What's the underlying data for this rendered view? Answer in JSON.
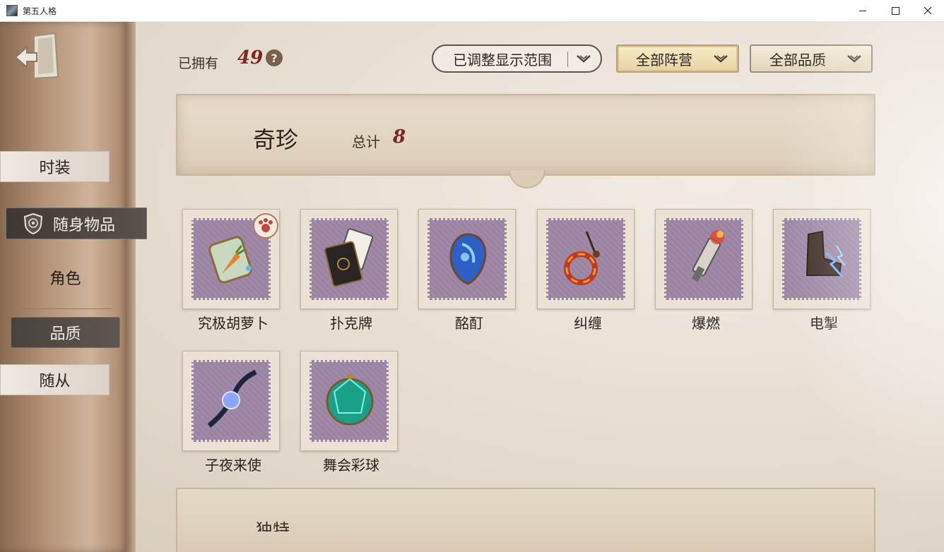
{
  "window": {
    "title": "第五人格"
  },
  "sidebar": {
    "tabs": [
      {
        "label": "时装"
      },
      {
        "label": "随身物品"
      },
      {
        "label": "角色"
      },
      {
        "label": "品质"
      },
      {
        "label": "随从"
      }
    ]
  },
  "header": {
    "owned_label": "已拥有",
    "owned_count": "49",
    "help": "?",
    "range_dropdown": "已调整显示范围",
    "faction_dropdown": "全部阵营",
    "quality_dropdown": "全部品质"
  },
  "category": {
    "title": "奇珍",
    "total_label": "总计",
    "total": "8"
  },
  "items": [
    {
      "name": "究极胡萝卜",
      "new": true
    },
    {
      "name": "扑克牌"
    },
    {
      "name": "酩酊"
    },
    {
      "name": "纠缠"
    },
    {
      "name": "爆燃"
    },
    {
      "name": "电掣"
    },
    {
      "name": "子夜来使"
    },
    {
      "name": "舞会彩球"
    }
  ],
  "next_category": {
    "title": "独特"
  },
  "colors": {
    "accent_number": "#7a2628",
    "stamp_purple": "#a08aa8",
    "panel_bg": "#e8dfd3"
  }
}
